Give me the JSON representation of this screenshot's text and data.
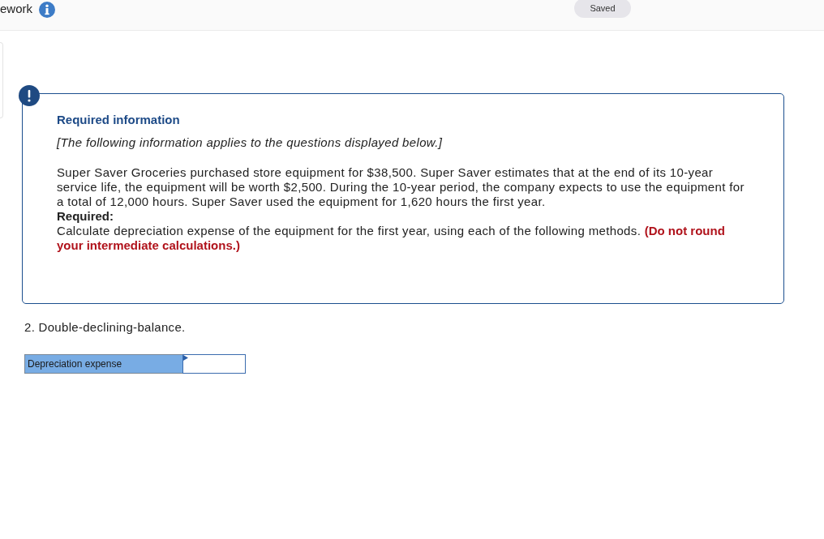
{
  "header": {
    "title": "ework",
    "status": "Saved"
  },
  "required_info": {
    "title": "Required information",
    "note": "[The following information applies to the questions displayed below.]",
    "paragraph": "Super Saver Groceries purchased store equipment for $38,500. Super Saver estimates that at the end of its 10-year service life, the equipment will be worth $2,500. During the 10-year period, the company expects to use the equipment for a total of 12,000 hours. Super Saver used the equipment for 1,620 hours the first year.",
    "required_label": "Required:",
    "instruction": "Calculate depreciation expense of the equipment for the first year, using each of the following methods. **(Do not round your intermediate calculations.)**"
  },
  "question": "2. Double-declining-balance.",
  "answer_table": {
    "rows": [
      {
        "label": "Depreciation expense"
      }
    ]
  }
}
